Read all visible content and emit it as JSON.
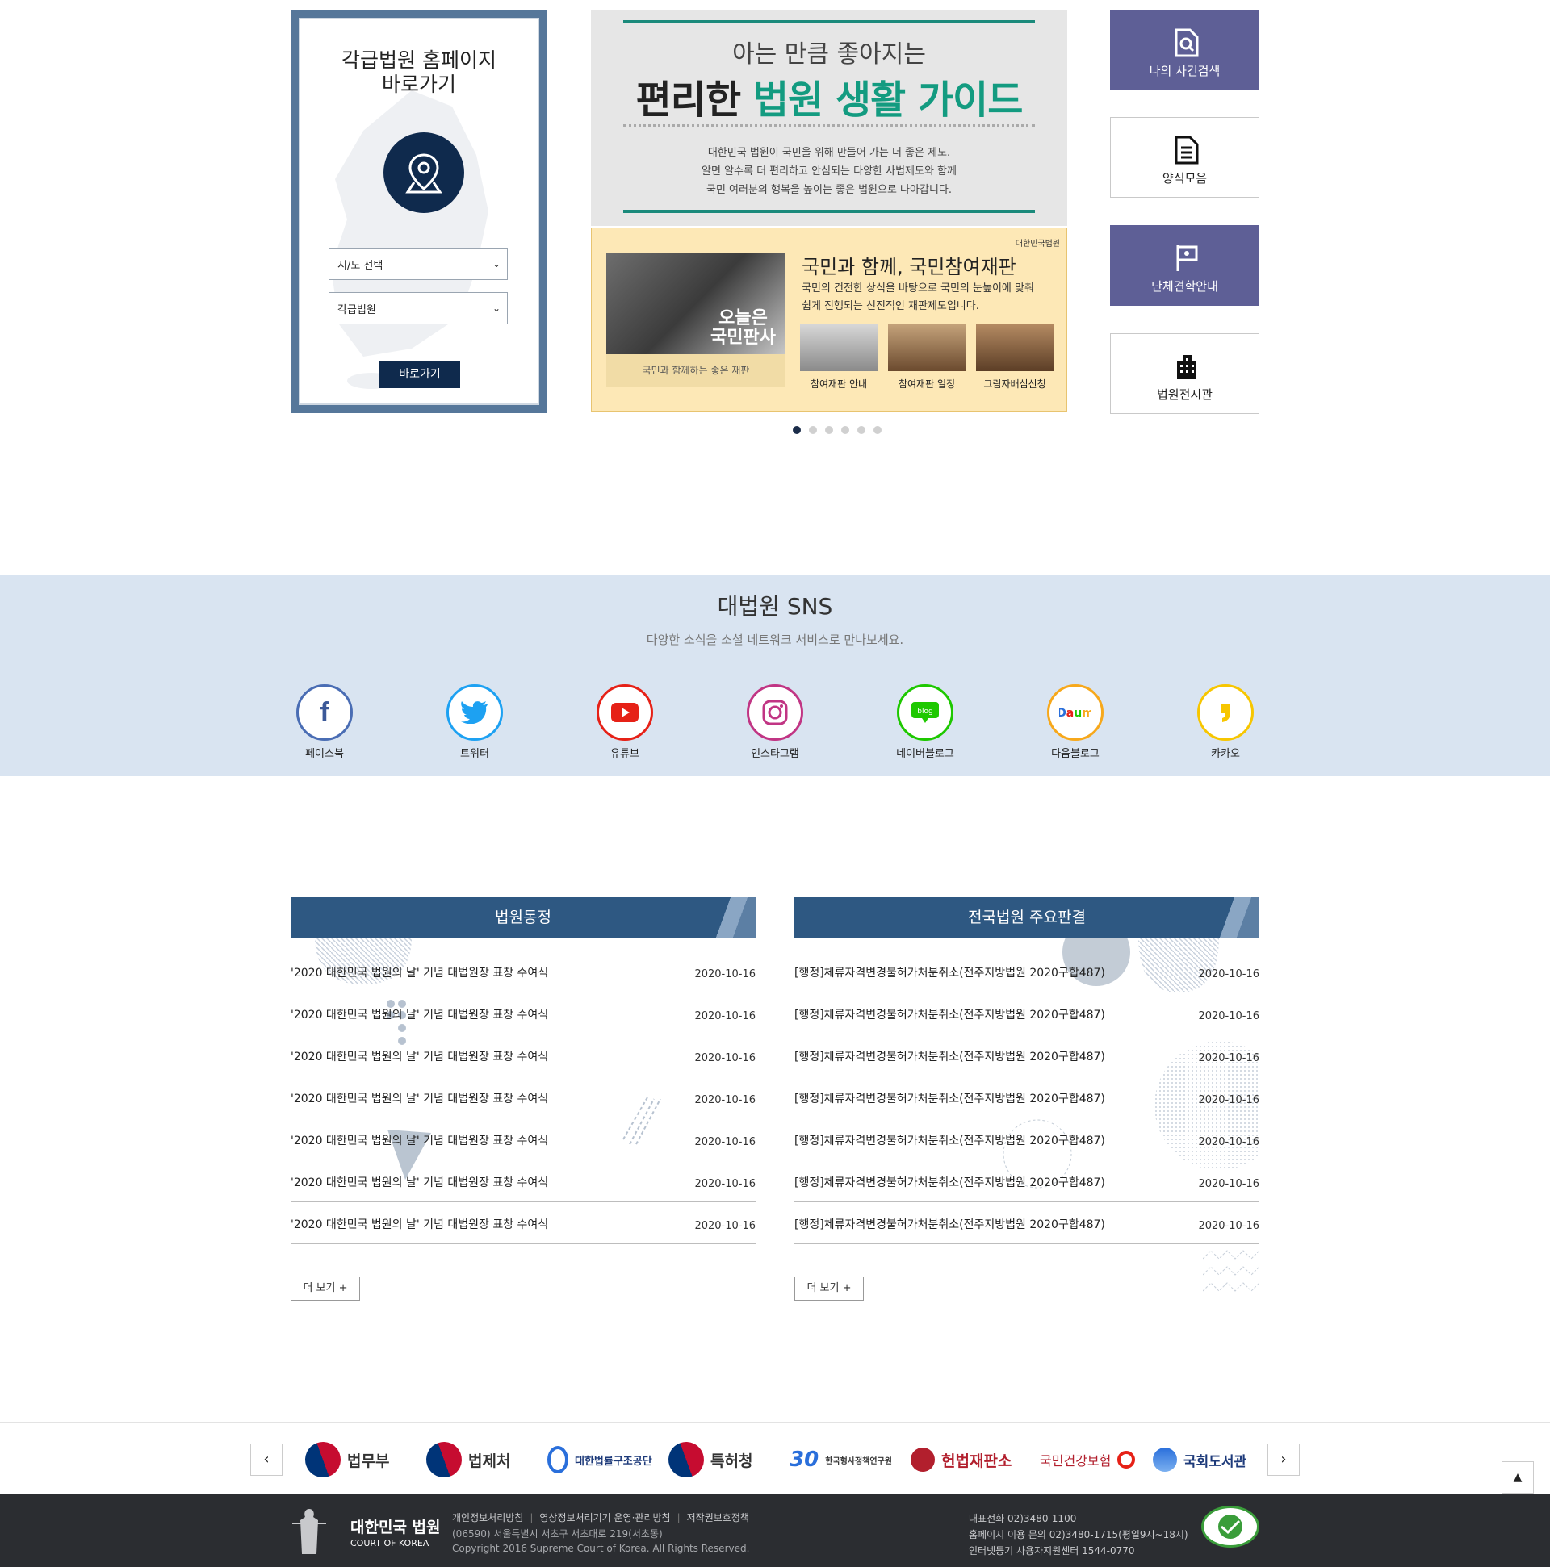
{
  "court_finder": {
    "title": "각급법원 홈페이지\n바로가기",
    "region_select": "시/도 선택",
    "court_select": "각급법원",
    "go_button": "바로가기"
  },
  "guide_banner": {
    "subtitle": "아는 만큼 좋아지는",
    "title_prefix": "편리한 ",
    "title_highlight": "법원 생활 가이드",
    "desc_1": "대한민국 법원이 국민을 위해 만들어 가는 더 좋은 제도.",
    "desc_2": "알면 알수록 더 편리하고 안심되는 다양한 사법제도와 함께",
    "desc_3": "국민 여러분의 행복을 높이는 좋은 법원으로 나아갑니다."
  },
  "trial_banner": {
    "logo": "대한민국법원",
    "photo_text_1": "오늘은",
    "photo_text_2": "국민판사",
    "caption": "국민과 함께하는 좋은 재판",
    "heading": "국민과 함께, 국민참여재판",
    "desc_1": "국민의 건전한 상식을 바탕으로 국민의 눈높이에 맞춰",
    "desc_2": "쉽게 진행되는 선진적인 재판제도입니다.",
    "thumbs": [
      "참여재판 안내",
      "참여재판 일정",
      "그림자배심신청"
    ]
  },
  "carousel": {
    "slide_count": 6,
    "active": 1
  },
  "quick_links": [
    "나의 사건검색",
    "양식모음",
    "단체견학안내",
    "법원전시관"
  ],
  "sns": {
    "title": "대법원 SNS",
    "subtitle": "다양한 소식을 소셜 네트워크 서비스로 만나보세요.",
    "items": [
      {
        "label": "페이스북",
        "icon": "facebook-icon",
        "color": "#3b5998"
      },
      {
        "label": "트위터",
        "icon": "twitter-icon",
        "color": "#1da1f2"
      },
      {
        "label": "유튜브",
        "icon": "youtube-icon",
        "color": "#e62117"
      },
      {
        "label": "인스타그램",
        "icon": "instagram-icon",
        "color": "#c13584"
      },
      {
        "label": "네이버블로그",
        "icon": "naver-blog-icon",
        "color": "#1ec800"
      },
      {
        "label": "다음블로그",
        "icon": "daum-blog-icon",
        "color": "#f7a81b"
      },
      {
        "label": "카카오",
        "icon": "kakao-icon",
        "color": "#f7c600"
      }
    ]
  },
  "news": {
    "title": "법원동정",
    "more": "더 보기 +",
    "rows": [
      {
        "title": "'2020 대한민국 법원의 날' 기념 대법원장 표창 수여식",
        "date": "2020-10-16"
      },
      {
        "title": "'2020 대한민국 법원의 날' 기념 대법원장 표창 수여식",
        "date": "2020-10-16"
      },
      {
        "title": "'2020 대한민국 법원의 날' 기념 대법원장 표창 수여식",
        "date": "2020-10-16"
      },
      {
        "title": "'2020 대한민국 법원의 날' 기념 대법원장 표창 수여식",
        "date": "2020-10-16"
      },
      {
        "title": "'2020 대한민국 법원의 날' 기념 대법원장 표창 수여식",
        "date": "2020-10-16"
      },
      {
        "title": "'2020 대한민국 법원의 날' 기념 대법원장 표창 수여식",
        "date": "2020-10-16"
      },
      {
        "title": "'2020 대한민국 법원의 날' 기념 대법원장 표창 수여식",
        "date": "2020-10-16"
      }
    ]
  },
  "rulings": {
    "title": "전국법원 주요판결",
    "more": "더 보기 +",
    "rows": [
      {
        "title": "[행정]체류자격변경불허가처분취소(전주지방법원 2020구합487)",
        "date": "2020-10-16"
      },
      {
        "title": "[행정]체류자격변경불허가처분취소(전주지방법원 2020구합487)",
        "date": "2020-10-16"
      },
      {
        "title": "[행정]체류자격변경불허가처분취소(전주지방법원 2020구합487)",
        "date": "2020-10-16"
      },
      {
        "title": "[행정]체류자격변경불허가처분취소(전주지방법원 2020구합487)",
        "date": "2020-10-16"
      },
      {
        "title": "[행정]체류자격변경불허가처분취소(전주지방법원 2020구합487)",
        "date": "2020-10-16"
      },
      {
        "title": "[행정]체류자격변경불허가처분취소(전주지방법원 2020구합487)",
        "date": "2020-10-16"
      },
      {
        "title": "[행정]체류자격변경불허가처분취소(전주지방법원 2020구합487)",
        "date": "2020-10-16"
      }
    ]
  },
  "partners": {
    "prev": "‹",
    "next": "›",
    "items": [
      "법무부",
      "법제처",
      "대한법률구조공단",
      "특허청",
      "한국형사정책연구원",
      "헌법재판소",
      "국민건강보험",
      "국회도서관"
    ]
  },
  "top_button": "▲",
  "footer": {
    "logo_name": "대한민국 법원",
    "logo_en": "COURT OF KOREA",
    "links": [
      "개인정보처리방침",
      "영상정보처리기기 운영·관리방침",
      "저작권보호정책"
    ],
    "address": "(06590) 서울특별시 서초구 서초대로 219(서초동)",
    "copyright": "Copyright 2016 Supreme Court of Korea. All Rights Reserved.",
    "phone": "대표전화 02)3480-1100",
    "inquiry": "홈페이지 이용 문의 02)3480-1715(평일9시~18시)",
    "registry": "인터넷등기 사용자지원센터 1544-0770"
  }
}
